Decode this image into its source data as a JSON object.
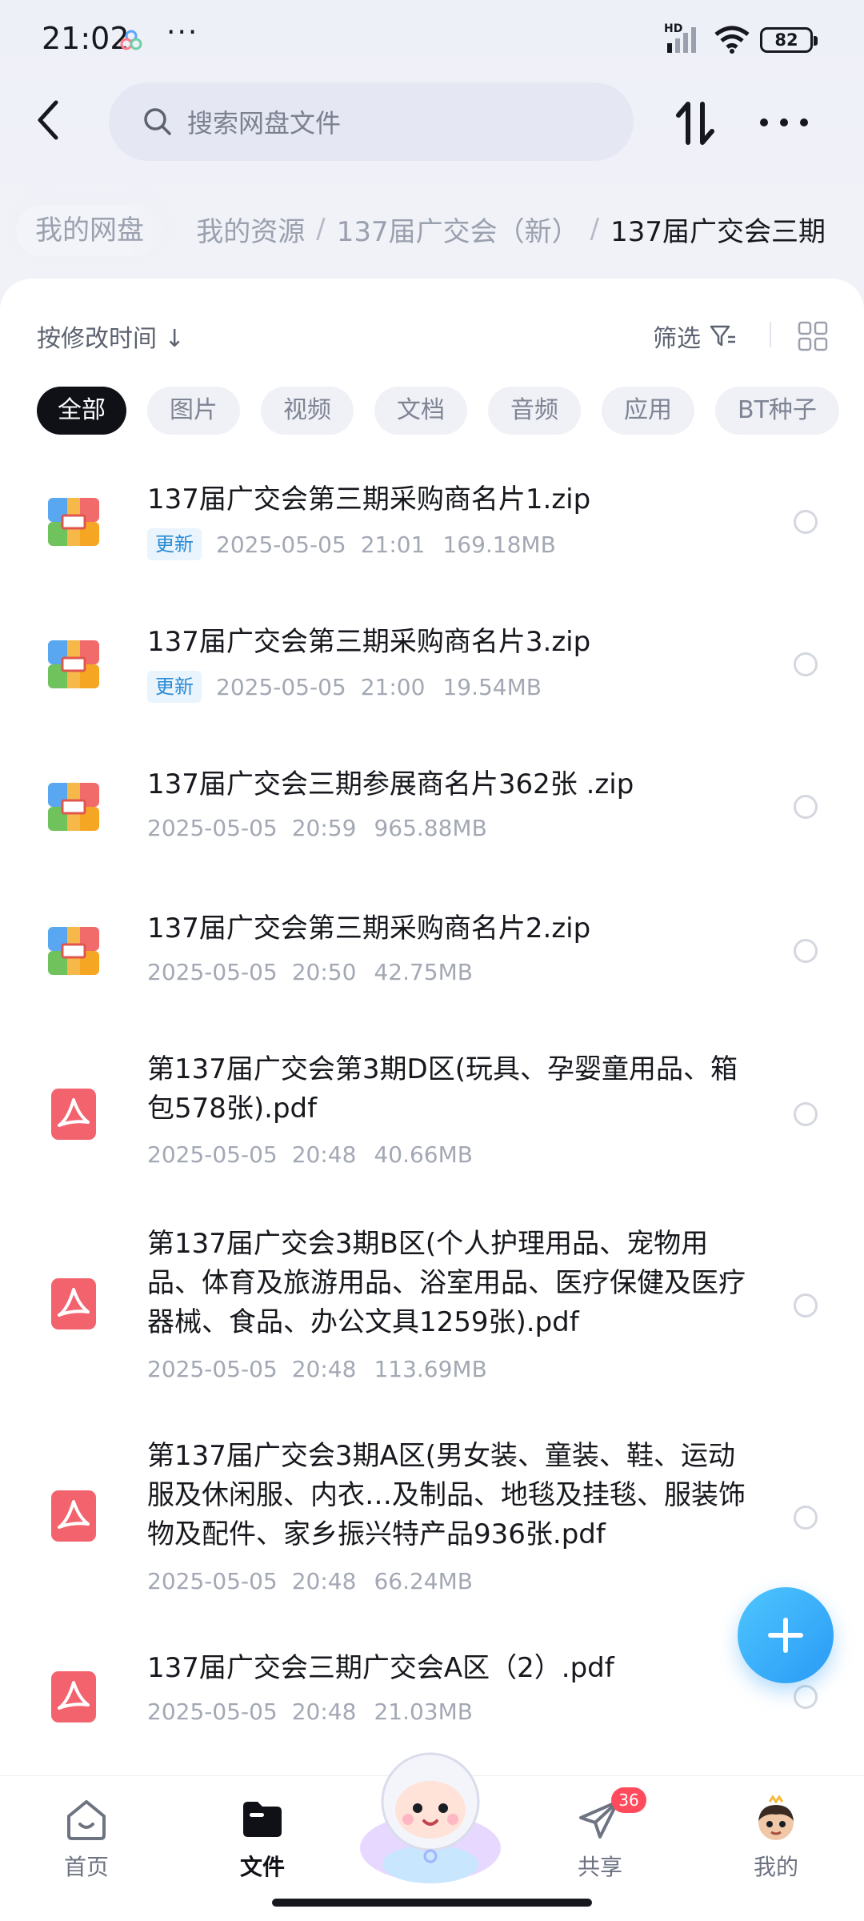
{
  "status_bar": {
    "time": "21:02",
    "dots": "···",
    "network": "HD",
    "battery": "82"
  },
  "header": {
    "back_icon": "chevron-left-icon",
    "search_placeholder": "搜索网盘文件",
    "sort_icon": "sort-arrows-icon",
    "more_icon": "more-horizontal-icon"
  },
  "breadcrumb": {
    "root": "我的网盘",
    "items": [
      "我的资源",
      "137届广交会（新）",
      "137届广交会三期"
    ],
    "separator": "/"
  },
  "toolbar": {
    "sort_label": "按修改时间 ↓",
    "filter_label": "筛选"
  },
  "tabs": [
    "全部",
    "图片",
    "视频",
    "文档",
    "音频",
    "应用",
    "BT种子"
  ],
  "files": [
    {
      "type": "zip",
      "name": "137届广交会第三期采购商名片1.zip",
      "tag": "更新",
      "date": "2025-05-05",
      "time": "21:01",
      "size": "169.18MB"
    },
    {
      "type": "zip",
      "name": "137届广交会第三期采购商名片3.zip",
      "tag": "更新",
      "date": "2025-05-05",
      "time": "21:00",
      "size": "19.54MB"
    },
    {
      "type": "zip",
      "name": "137届广交会三期参展商名片362张 .zip",
      "tag": "",
      "date": "2025-05-05",
      "time": "20:59",
      "size": "965.88MB"
    },
    {
      "type": "zip",
      "name": "137届广交会第三期采购商名片2.zip",
      "tag": "",
      "date": "2025-05-05",
      "time": "20:50",
      "size": "42.75MB"
    },
    {
      "type": "pdf",
      "name": "第137届广交会第3期D区(玩具、孕婴童用品、箱包578张).pdf",
      "tag": "",
      "date": "2025-05-05",
      "time": "20:48",
      "size": "40.66MB"
    },
    {
      "type": "pdf",
      "name": "第137届广交会3期B区(个人护理用品、宠物用品、体育及旅游用品、浴室用品、医疗保健及医疗器械、食品、办公文具1259张).pdf",
      "tag": "",
      "date": "2025-05-05",
      "time": "20:48",
      "size": "113.69MB"
    },
    {
      "type": "pdf",
      "name": "第137届广交会3期A区(男女装、童装、鞋、运动服及休闲服、内衣…及制品、地毯及挂毯、服装饰物及配件、家乡振兴特产品936张.pdf",
      "tag": "",
      "date": "2025-05-05",
      "time": "20:48",
      "size": "66.24MB"
    },
    {
      "type": "pdf",
      "name": "137届广交会三期广交会A区（2）.pdf",
      "tag": "",
      "date": "2025-05-05",
      "time": "20:48",
      "size": "21.03MB"
    }
  ],
  "bottom_nav": [
    {
      "label": "首页",
      "icon": "home-icon"
    },
    {
      "label": "文件",
      "icon": "folder-icon",
      "active": true
    },
    {
      "label": "",
      "icon": "mascot-icon"
    },
    {
      "label": "共享",
      "icon": "paper-plane-icon",
      "badge": "36"
    },
    {
      "label": "我的",
      "icon": "avatar-icon"
    }
  ],
  "colors": {
    "accent": "#2a9af5",
    "active_tab": "#0f1116",
    "tag_bg": "#eaf4fd",
    "tag_text": "#2a8bd6",
    "badge": "#ff4b5c",
    "pdf_icon": "#f2636e"
  }
}
